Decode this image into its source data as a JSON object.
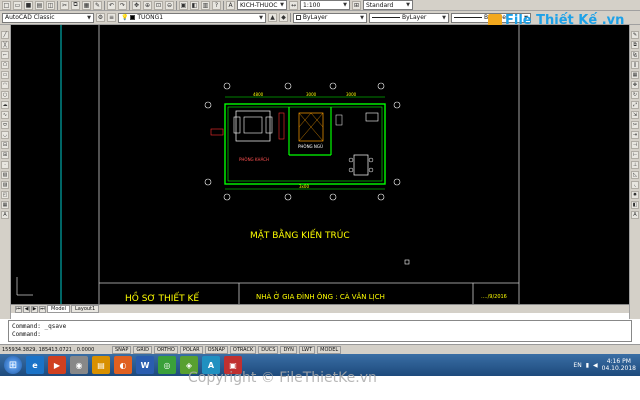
{
  "toolbar": {
    "workspace": "AutoCAD Classic",
    "layer": "TUONG1",
    "dim_style": "KICH-THUOC",
    "scale": "1:100",
    "text_style": "Standard",
    "color": "ByLayer",
    "linetype": "ByLayer",
    "lineweight": "ByLayer"
  },
  "logo": {
    "text": "File Thiết Kế .vn"
  },
  "drawing": {
    "plan_title": "MẶT BẰNG KIẾN TRÚC",
    "room1": "PHÒNG KHÁCH",
    "room2": "PHÒNG NGỦ",
    "dim_total": "3x00",
    "dim_a": "4800",
    "dim_b": "3000",
    "dim_c": "3000",
    "title_block_left": "HỒ SƠ THIẾT KẾ",
    "title_block_mid": "NHÀ Ở GIA ĐÌNH ÔNG : CÀ VĂN LỊCH",
    "title_block_date": "…./9/2016"
  },
  "tabs": {
    "model": "Model",
    "layout1": "Layout1"
  },
  "command": {
    "line1": "Command: _qsave",
    "line2": "Command:"
  },
  "status": {
    "coords": "155934.3829, 185413.0721 , 0.0000",
    "buttons": [
      "SNAP",
      "GRID",
      "ORTHO",
      "POLAR",
      "OSNAP",
      "OTRACK",
      "DUCS",
      "DYN",
      "LWT",
      "MODEL"
    ]
  },
  "tray": {
    "lang": "EN",
    "time": "4:16 PM",
    "date": "04.10.2018"
  },
  "watermark": "Copyright © FileThietKe.vn",
  "colors": {
    "canvas": "#000000",
    "accent_yellow": "#ffff00",
    "plan_green": "#00ff00",
    "plan_white": "#ffffff"
  }
}
